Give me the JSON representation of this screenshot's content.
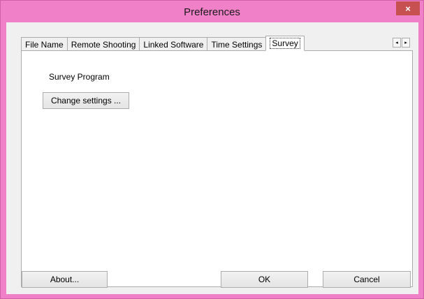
{
  "window": {
    "title": "Preferences",
    "close_glyph": "×"
  },
  "tabs": [
    {
      "label": "File Name",
      "active": false
    },
    {
      "label": "Remote Shooting",
      "active": false
    },
    {
      "label": "Linked Software",
      "active": false
    },
    {
      "label": "Time Settings",
      "active": false
    },
    {
      "label": "Survey",
      "active": true
    }
  ],
  "tab_scroll": {
    "left_glyph": "◂",
    "right_glyph": "▸"
  },
  "panel": {
    "section_label": "Survey Program",
    "change_button": "Change settings ..."
  },
  "footer": {
    "about_label": "About...",
    "ok_label": "OK",
    "cancel_label": "Cancel"
  },
  "colors": {
    "titlebar": "#f080c8",
    "close_button": "#c75050",
    "client_bg": "#f0f0f0",
    "panel_bg": "#ffffff"
  }
}
